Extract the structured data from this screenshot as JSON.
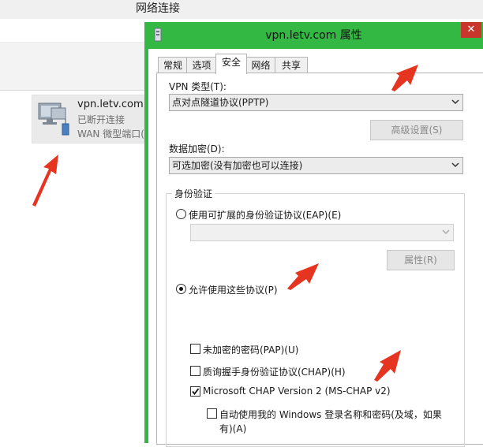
{
  "background_window": {
    "title": "网络连接",
    "connection": {
      "name": "vpn.letv.com",
      "status": "已断开连接",
      "device": "WAN 微型端口(PPTP)"
    }
  },
  "dialog": {
    "title": "vpn.letv.com 属性",
    "close_glyph": "✕",
    "tabs": [
      {
        "label": "常规",
        "active": false
      },
      {
        "label": "选项",
        "active": false
      },
      {
        "label": "安全",
        "active": true
      },
      {
        "label": "网络",
        "active": false
      },
      {
        "label": "共享",
        "active": false
      }
    ],
    "vpn_type": {
      "label": "VPN 类型(T):",
      "value": "点对点隧道协议(PPTP)"
    },
    "advanced_button": "高级设置(S)",
    "encryption": {
      "label": "数据加密(D):",
      "value": "可选加密(没有加密也可以连接)"
    },
    "auth": {
      "group_title": "身份验证",
      "eap_radio": {
        "label": "使用可扩展的身份验证协议(EAP)(E)",
        "checked": false
      },
      "eap_select_value": "",
      "properties_button": "属性(R)",
      "allow_radio": {
        "label": "允许使用这些协议(P)",
        "checked": true
      },
      "pap": {
        "label": "未加密的密码(PAP)(U)",
        "checked": false
      },
      "chap": {
        "label": "质询握手身份验证协议(CHAP)(H)",
        "checked": false
      },
      "mschapv2": {
        "label": "Microsoft CHAP Version 2 (MS-CHAP v2)",
        "checked": true
      },
      "auto_login": {
        "label_line1": "自动使用我的 Windows 登录名称和密码(及域，如果",
        "label_line2": "有)(A)",
        "checked": false
      }
    }
  },
  "colors": {
    "dialog_frame": "#33b843",
    "close_button": "#c9362b",
    "arrow": "#e5341f"
  }
}
